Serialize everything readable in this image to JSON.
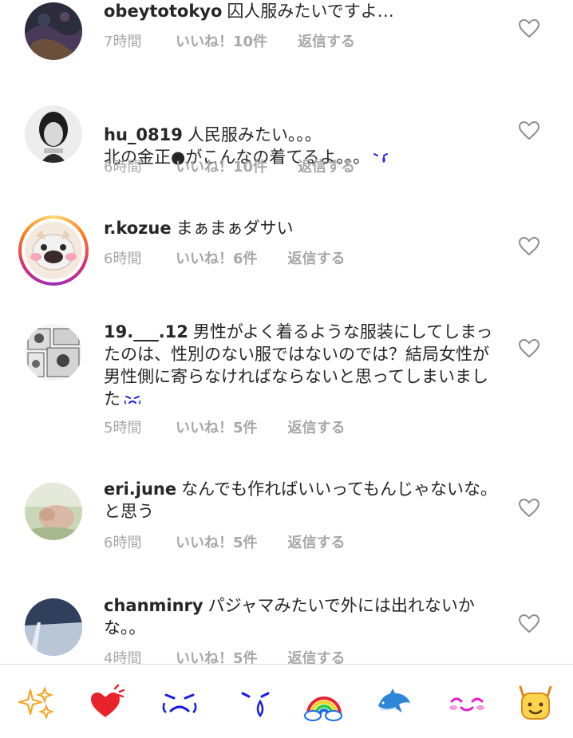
{
  "comments": [
    {
      "username": "obeytotokyo",
      "text": "囚人服みたいですよ…",
      "time": "7時間",
      "likes": "いいね！10件",
      "reply": "返信する"
    },
    {
      "username": "hu_0819",
      "text": "人民服みたい。。。\n北の金正●がこんなの着てるよ。。。",
      "time": "6時間",
      "likes": "いいね！10件",
      "reply": "返信する"
    },
    {
      "username": "r.kozue",
      "text": "まぁまぁダサい",
      "time": "6時間",
      "likes": "いいね！6件",
      "reply": "返信する"
    },
    {
      "username": "19.___.12",
      "text": "男性がよく着るような服装にしてしまったのは、性別のない服ではないのでは？結局女性が男性側に寄らなければならないと思ってしまいました",
      "time": "5時間",
      "likes": "いいね！5件",
      "reply": "返信する"
    },
    {
      "username": "eri.june",
      "text": "なんでも作ればいいってもんじゃないな。と思う",
      "time": "6時間",
      "likes": "いいね！5件",
      "reply": "返信する"
    },
    {
      "username": "chanminry",
      "text": "パジャマみたいで外には出れないかな。。",
      "time": "4時間",
      "likes": "いいね！5件",
      "reply": "返信する"
    }
  ],
  "emoji_bar": [
    "sparkles-emoji",
    "heart-emoji",
    "crying-face-emoji",
    "tearful-face-emoji",
    "rainbow-emoji",
    "dolphin-emoji",
    "smiling-face-emoji",
    "cheering-face-emoji"
  ],
  "colors": {
    "username": "#262626",
    "meta": "#a8a8a8",
    "heart_outline": "#8e8e8e",
    "emoji_blue": "#1a1ae6"
  }
}
